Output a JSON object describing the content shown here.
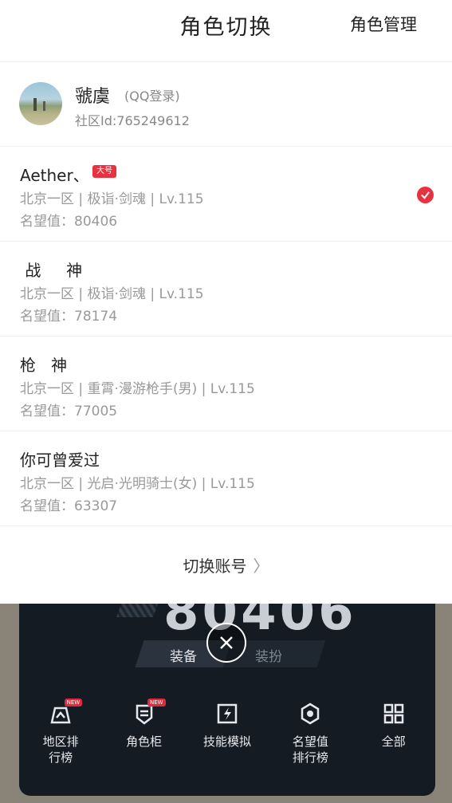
{
  "header": {
    "title": "角色切换",
    "manage_label": "角色管理"
  },
  "account": {
    "name": "虢虞",
    "login_type": "(QQ登录)",
    "community_id": "社区Id:765249612"
  },
  "roles": [
    {
      "name": "Aether、",
      "badge": "大号",
      "detail": "北京一区 | 极诣·剑魂 | Lv.115",
      "fame": "名望值：80406",
      "selected": true
    },
    {
      "name": " 战     神",
      "badge": "",
      "detail": "北京一区 | 极诣·剑魂 | Lv.115",
      "fame": "名望值：78174",
      "selected": false
    },
    {
      "name": "枪   神",
      "badge": "",
      "detail": "北京一区 | 重霄·漫游枪手(男) | Lv.115",
      "fame": "名望值：77005",
      "selected": false
    },
    {
      "name": "你可曾爱过",
      "badge": "",
      "detail": "北京一区 | 光启·光明骑士(女) | Lv.115",
      "fame": "名望值：63307",
      "selected": false
    }
  ],
  "switch_account": {
    "label": "切换账号",
    "arrow": "〉"
  },
  "background": {
    "score": "80406",
    "tabs": {
      "equip": "装备",
      "dress": "装扮"
    },
    "icons": [
      {
        "icon": "map-rank-icon",
        "label": "地区排\n行榜",
        "new": "NEW"
      },
      {
        "icon": "wardrobe-icon",
        "label": "角色柜",
        "new": "NEW"
      },
      {
        "icon": "skill-icon",
        "label": "技能模拟",
        "new": ""
      },
      {
        "icon": "fame-rank-icon",
        "label": "名望值\n排行榜",
        "new": ""
      },
      {
        "icon": "grid-icon",
        "label": "全部",
        "new": ""
      }
    ]
  },
  "colors": {
    "accent": "#e8323f",
    "card": "#141b22",
    "backdrop": "#8a8378"
  }
}
